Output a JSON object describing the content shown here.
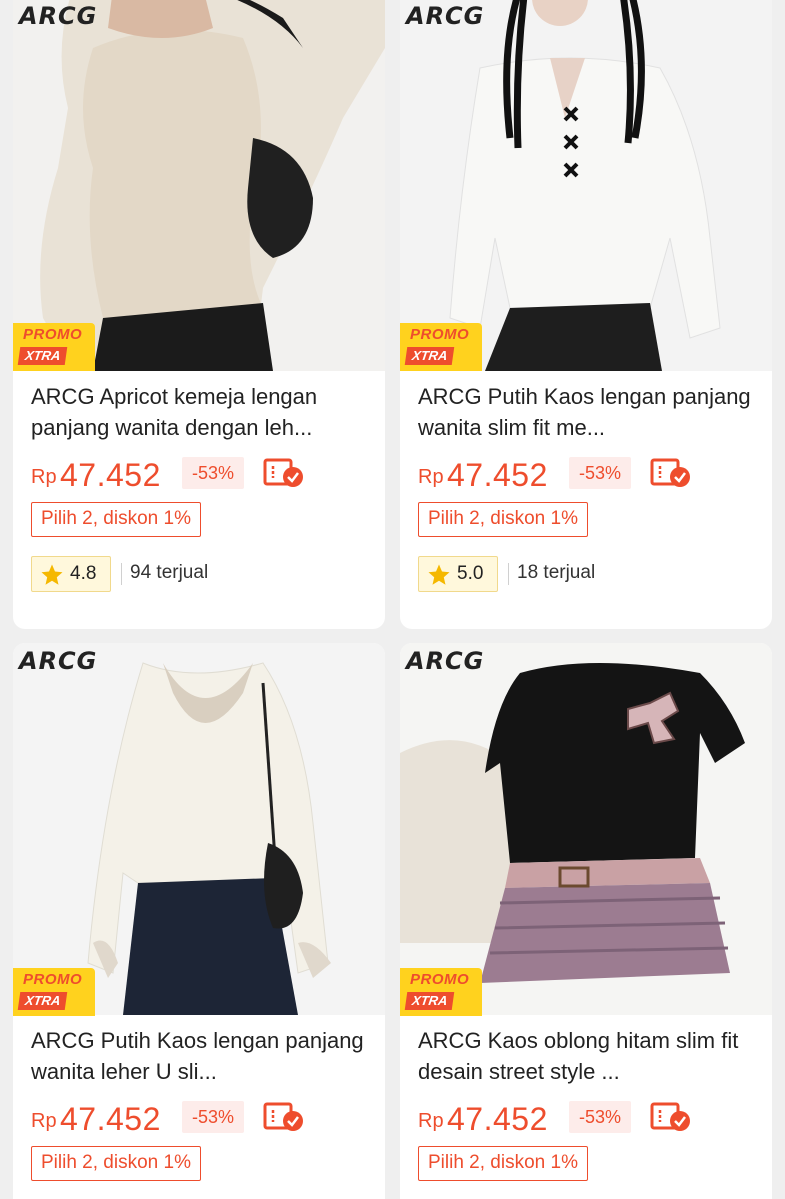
{
  "colors": {
    "accent": "#ee4d2d",
    "promo_yellow": "#ffd21e",
    "star": "#f5b800"
  },
  "products": [
    {
      "brand_logo": "ARCG",
      "promo_top": "PROMO",
      "promo_bottom": "XTRA",
      "title": "ARCG Apricot kemeja lengan panjang wanita dengan leh...",
      "currency": "Rp",
      "price": "47.452",
      "discount": "-53%",
      "bundle": "Pilih 2, diskon 1%",
      "rating": "4.8",
      "sold": "94 terjual"
    },
    {
      "brand_logo": "ARCG",
      "promo_top": "PROMO",
      "promo_bottom": "XTRA",
      "title": "ARCG Putih Kaos lengan panjang wanita slim fit me...",
      "currency": "Rp",
      "price": "47.452",
      "discount": "-53%",
      "bundle": "Pilih 2, diskon 1%",
      "rating": "5.0",
      "sold": "18 terjual"
    },
    {
      "brand_logo": "ARCG",
      "promo_top": "PROMO",
      "promo_bottom": "XTRA",
      "title": "ARCG Putih Kaos lengan panjang wanita leher U sli...",
      "currency": "Rp",
      "price": "47.452",
      "discount": "-53%",
      "bundle": "Pilih 2, diskon 1%"
    },
    {
      "brand_logo": "ARCG",
      "promo_top": "PROMO",
      "promo_bottom": "XTRA",
      "title": "ARCG Kaos oblong hitam slim fit desain street style ...",
      "currency": "Rp",
      "price": "47.452",
      "discount": "-53%",
      "bundle": "Pilih 2, diskon 1%"
    }
  ]
}
